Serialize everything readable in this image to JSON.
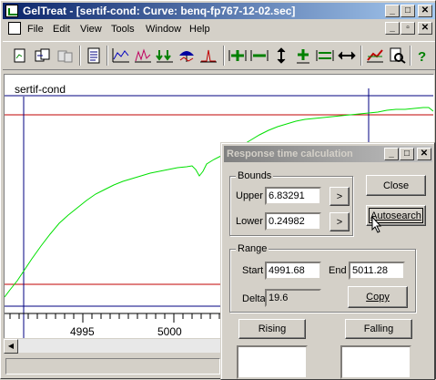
{
  "window": {
    "title": "GelTreat - [sertif-cond: Curve: benq-fp767-12-02.sec]"
  },
  "menu": [
    "File",
    "Edit",
    "View",
    "Tools",
    "Window",
    "Help"
  ],
  "plot": {
    "channel_label": "sertif-cond",
    "x_ticks": [
      "4995",
      "5000"
    ]
  },
  "dialog": {
    "title": "Response time calculation",
    "bounds": {
      "group_label": "Bounds",
      "upper_label": "Upper",
      "upper_value": "6.83291",
      "lower_label": "Lower",
      "lower_value": "0.24982",
      "arrow": ">"
    },
    "range": {
      "group_label": "Range",
      "start_label": "Start",
      "start_value": "4991.68",
      "end_label": "End",
      "end_value": "5011.28",
      "delta_label": "Delta",
      "delta_value": "19.6",
      "copy_label": "Copy"
    },
    "close_label": "Close",
    "autosearch_label": "Autosearch",
    "rising_label": "Rising",
    "falling_label": "Falling"
  },
  "colors": {
    "curve": "#00e000",
    "bound_line": "#c00000",
    "marker_line": "#000080",
    "title_active": "#0a246a",
    "title_inactive": "#808080"
  }
}
